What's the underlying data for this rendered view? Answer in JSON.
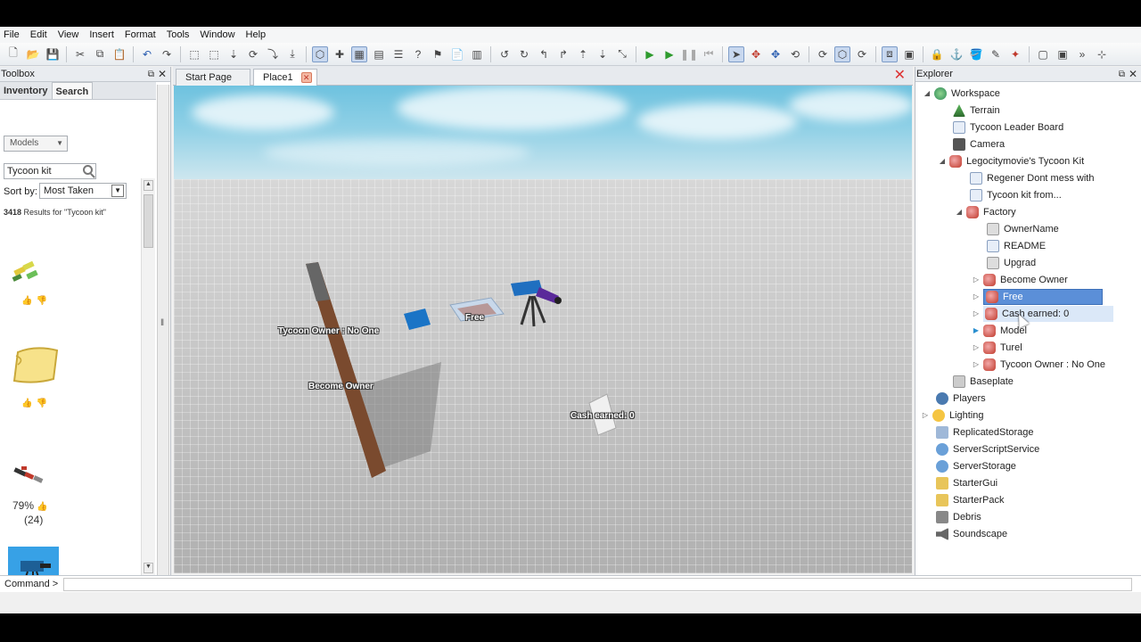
{
  "menu": [
    "File",
    "Edit",
    "View",
    "Insert",
    "Format",
    "Tools",
    "Window",
    "Help"
  ],
  "toolbox": {
    "title": "Toolbox",
    "tabs": [
      "Inventory",
      "Search"
    ],
    "category": "Models",
    "search_value": "Tycoon kit",
    "sort_label": "Sort by:",
    "sort_value": "Most Taken",
    "results_count": "3418",
    "results_text": " Results for \"Tycoon kit\"",
    "rating_percent": "79%",
    "rating_count": "(24)"
  },
  "tabs": {
    "start_page": "Start Page",
    "place": "Place1"
  },
  "viewport": {
    "labels": {
      "tycoon_owner": "Tycoon Owner : No One",
      "free": "Free",
      "become_owner": "Become Owner",
      "cash_earned": "Cash earned: 0"
    }
  },
  "explorer": {
    "title": "Explorer",
    "items": [
      {
        "label": "Workspace",
        "icon": "workspace-icon"
      },
      {
        "label": "Terrain",
        "icon": "terrain-icon"
      },
      {
        "label": "Tycoon Leader Board",
        "icon": "script-icon"
      },
      {
        "label": "Camera",
        "icon": "camera-icon"
      },
      {
        "label": "Legocitymovie's Tycoon Kit",
        "icon": "model-icon"
      },
      {
        "label": "Regener Dont mess with",
        "icon": "script-icon"
      },
      {
        "label": "Tycoon kit from...",
        "icon": "script-icon"
      },
      {
        "label": "Factory",
        "icon": "model-icon"
      },
      {
        "label": "OwnerName",
        "icon": "value-icon"
      },
      {
        "label": "README",
        "icon": "script-icon"
      },
      {
        "label": "Upgrad",
        "icon": "value-icon"
      },
      {
        "label": "Become Owner",
        "icon": "model-icon"
      },
      {
        "label": "Free",
        "icon": "model-icon"
      },
      {
        "label": "Cash earned: 0",
        "icon": "model-icon"
      },
      {
        "label": "Model",
        "icon": "model-icon"
      },
      {
        "label": "Turel",
        "icon": "model-icon"
      },
      {
        "label": "Tycoon Owner : No One",
        "icon": "model-icon"
      },
      {
        "label": "Baseplate",
        "icon": "part-icon"
      },
      {
        "label": "Players",
        "icon": "players-icon"
      },
      {
        "label": "Lighting",
        "icon": "lighting-icon"
      },
      {
        "label": "ReplicatedStorage",
        "icon": "storage-icon"
      },
      {
        "label": "ServerScriptService",
        "icon": "service-icon"
      },
      {
        "label": "ServerStorage",
        "icon": "service-icon"
      },
      {
        "label": "StarterGui",
        "icon": "folder-icon"
      },
      {
        "label": "StarterPack",
        "icon": "folder-icon"
      },
      {
        "label": "Debris",
        "icon": "debris-icon"
      },
      {
        "label": "Soundscape",
        "icon": "sound-icon"
      }
    ]
  },
  "command": {
    "label": "Command >"
  },
  "colors": {
    "selection": "#5b8fd8",
    "sky": "#8fd0e6",
    "baseplate": "#c0c0c0"
  }
}
